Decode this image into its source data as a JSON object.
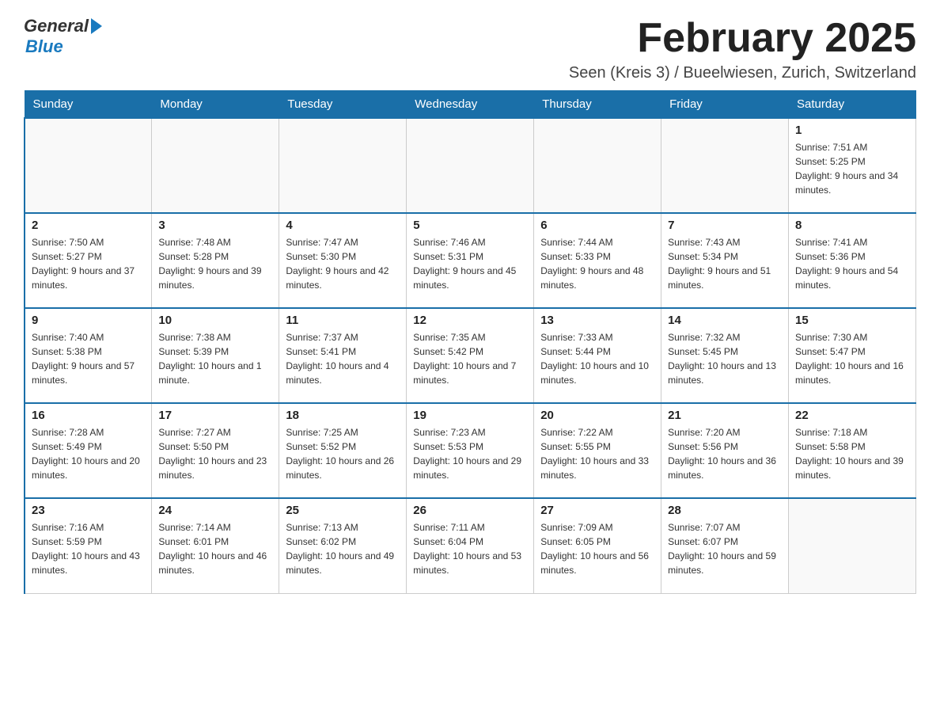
{
  "header": {
    "logo_general": "General",
    "logo_blue": "Blue",
    "month_title": "February 2025",
    "location": "Seen (Kreis 3) / Bueelwiesen, Zurich, Switzerland"
  },
  "weekdays": [
    "Sunday",
    "Monday",
    "Tuesday",
    "Wednesday",
    "Thursday",
    "Friday",
    "Saturday"
  ],
  "weeks": [
    [
      {
        "day": "",
        "info": ""
      },
      {
        "day": "",
        "info": ""
      },
      {
        "day": "",
        "info": ""
      },
      {
        "day": "",
        "info": ""
      },
      {
        "day": "",
        "info": ""
      },
      {
        "day": "",
        "info": ""
      },
      {
        "day": "1",
        "info": "Sunrise: 7:51 AM\nSunset: 5:25 PM\nDaylight: 9 hours and 34 minutes."
      }
    ],
    [
      {
        "day": "2",
        "info": "Sunrise: 7:50 AM\nSunset: 5:27 PM\nDaylight: 9 hours and 37 minutes."
      },
      {
        "day": "3",
        "info": "Sunrise: 7:48 AM\nSunset: 5:28 PM\nDaylight: 9 hours and 39 minutes."
      },
      {
        "day": "4",
        "info": "Sunrise: 7:47 AM\nSunset: 5:30 PM\nDaylight: 9 hours and 42 minutes."
      },
      {
        "day": "5",
        "info": "Sunrise: 7:46 AM\nSunset: 5:31 PM\nDaylight: 9 hours and 45 minutes."
      },
      {
        "day": "6",
        "info": "Sunrise: 7:44 AM\nSunset: 5:33 PM\nDaylight: 9 hours and 48 minutes."
      },
      {
        "day": "7",
        "info": "Sunrise: 7:43 AM\nSunset: 5:34 PM\nDaylight: 9 hours and 51 minutes."
      },
      {
        "day": "8",
        "info": "Sunrise: 7:41 AM\nSunset: 5:36 PM\nDaylight: 9 hours and 54 minutes."
      }
    ],
    [
      {
        "day": "9",
        "info": "Sunrise: 7:40 AM\nSunset: 5:38 PM\nDaylight: 9 hours and 57 minutes."
      },
      {
        "day": "10",
        "info": "Sunrise: 7:38 AM\nSunset: 5:39 PM\nDaylight: 10 hours and 1 minute."
      },
      {
        "day": "11",
        "info": "Sunrise: 7:37 AM\nSunset: 5:41 PM\nDaylight: 10 hours and 4 minutes."
      },
      {
        "day": "12",
        "info": "Sunrise: 7:35 AM\nSunset: 5:42 PM\nDaylight: 10 hours and 7 minutes."
      },
      {
        "day": "13",
        "info": "Sunrise: 7:33 AM\nSunset: 5:44 PM\nDaylight: 10 hours and 10 minutes."
      },
      {
        "day": "14",
        "info": "Sunrise: 7:32 AM\nSunset: 5:45 PM\nDaylight: 10 hours and 13 minutes."
      },
      {
        "day": "15",
        "info": "Sunrise: 7:30 AM\nSunset: 5:47 PM\nDaylight: 10 hours and 16 minutes."
      }
    ],
    [
      {
        "day": "16",
        "info": "Sunrise: 7:28 AM\nSunset: 5:49 PM\nDaylight: 10 hours and 20 minutes."
      },
      {
        "day": "17",
        "info": "Sunrise: 7:27 AM\nSunset: 5:50 PM\nDaylight: 10 hours and 23 minutes."
      },
      {
        "day": "18",
        "info": "Sunrise: 7:25 AM\nSunset: 5:52 PM\nDaylight: 10 hours and 26 minutes."
      },
      {
        "day": "19",
        "info": "Sunrise: 7:23 AM\nSunset: 5:53 PM\nDaylight: 10 hours and 29 minutes."
      },
      {
        "day": "20",
        "info": "Sunrise: 7:22 AM\nSunset: 5:55 PM\nDaylight: 10 hours and 33 minutes."
      },
      {
        "day": "21",
        "info": "Sunrise: 7:20 AM\nSunset: 5:56 PM\nDaylight: 10 hours and 36 minutes."
      },
      {
        "day": "22",
        "info": "Sunrise: 7:18 AM\nSunset: 5:58 PM\nDaylight: 10 hours and 39 minutes."
      }
    ],
    [
      {
        "day": "23",
        "info": "Sunrise: 7:16 AM\nSunset: 5:59 PM\nDaylight: 10 hours and 43 minutes."
      },
      {
        "day": "24",
        "info": "Sunrise: 7:14 AM\nSunset: 6:01 PM\nDaylight: 10 hours and 46 minutes."
      },
      {
        "day": "25",
        "info": "Sunrise: 7:13 AM\nSunset: 6:02 PM\nDaylight: 10 hours and 49 minutes."
      },
      {
        "day": "26",
        "info": "Sunrise: 7:11 AM\nSunset: 6:04 PM\nDaylight: 10 hours and 53 minutes."
      },
      {
        "day": "27",
        "info": "Sunrise: 7:09 AM\nSunset: 6:05 PM\nDaylight: 10 hours and 56 minutes."
      },
      {
        "day": "28",
        "info": "Sunrise: 7:07 AM\nSunset: 6:07 PM\nDaylight: 10 hours and 59 minutes."
      },
      {
        "day": "",
        "info": ""
      }
    ]
  ]
}
